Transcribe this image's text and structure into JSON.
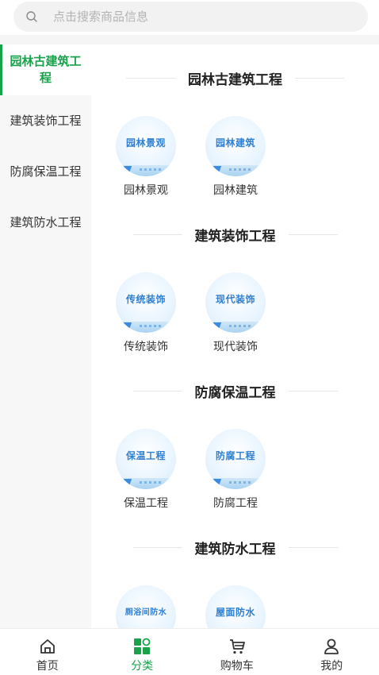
{
  "search": {
    "placeholder": "点击搜索商品信息"
  },
  "sidebar": {
    "items": [
      {
        "label": "园林古建筑工程",
        "active": true
      },
      {
        "label": "建筑装饰工程",
        "active": false
      },
      {
        "label": "防腐保温工程",
        "active": false
      },
      {
        "label": "建筑防水工程",
        "active": false
      }
    ]
  },
  "sections": [
    {
      "title": "园林古建筑工程",
      "items": [
        {
          "thumb_text": "园林景观",
          "label": "园林景观"
        },
        {
          "thumb_text": "园林建筑",
          "label": "园林建筑"
        }
      ]
    },
    {
      "title": "建筑装饰工程",
      "items": [
        {
          "thumb_text": "传统装饰",
          "label": "传统装饰"
        },
        {
          "thumb_text": "现代装饰",
          "label": "现代装饰"
        }
      ]
    },
    {
      "title": "防腐保温工程",
      "items": [
        {
          "thumb_text": "保温工程",
          "label": "保温工程"
        },
        {
          "thumb_text": "防腐工程",
          "label": "防腐工程"
        }
      ]
    },
    {
      "title": "建筑防水工程",
      "items": [
        {
          "thumb_text": "厕浴间防水",
          "label": ""
        },
        {
          "thumb_text": "屋面防水",
          "label": ""
        }
      ]
    }
  ],
  "tabbar": {
    "tabs": [
      {
        "label": "首页",
        "icon": "home-icon"
      },
      {
        "label": "分类",
        "icon": "category-icon"
      },
      {
        "label": "购物车",
        "icon": "cart-icon"
      },
      {
        "label": "我的",
        "icon": "user-icon"
      }
    ],
    "active_color": "#18a34a"
  }
}
